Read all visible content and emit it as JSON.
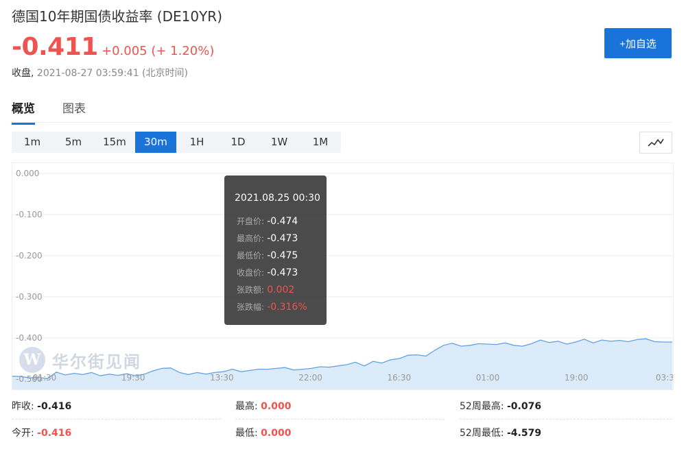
{
  "header": {
    "title": "德国10年期国债收益率 (DE10YR)",
    "price": "-0.411",
    "change": "+0.005 (+ 1.20%)",
    "status_label": "收盘,",
    "status_time": "2021-08-27 03:59:41 (北京时间)",
    "add_button": "+加自选"
  },
  "tabs": [
    "概览",
    "图表"
  ],
  "periods": [
    "1m",
    "5m",
    "15m",
    "30m",
    "1H",
    "1D",
    "1W",
    "1M"
  ],
  "active_period": "30m",
  "tooltip": {
    "date": "2021.08.25 00:30",
    "open_label": "开盘价:",
    "open": "-0.474",
    "high_label": "最高价:",
    "high": "-0.473",
    "low_label": "最低价:",
    "low": "-0.475",
    "close_label": "收盘价:",
    "close": "-0.473",
    "chg_label": "张跌额:",
    "chg": "0.002",
    "pct_label": "张跌幅:",
    "pct": "-0.316%"
  },
  "watermark": {
    "logo": "W",
    "text": "华尔街见闻"
  },
  "chart_data": {
    "type": "area",
    "y_ticks": [
      "0.000",
      "-0.100",
      "-0.200",
      "-0.300",
      "-0.400",
      "-0.500"
    ],
    "y_range": [
      -0.5,
      0.0
    ],
    "x_ticks": [
      "01:30",
      "19:30",
      "13:30",
      "22:00",
      "16:30",
      "01:00",
      "19:00",
      "03:3"
    ],
    "series": [
      {
        "values": [
          -0.493,
          -0.494,
          -0.497,
          -0.496,
          -0.499,
          -0.483,
          -0.49,
          -0.486,
          -0.489,
          -0.484,
          -0.492,
          -0.488,
          -0.491,
          -0.487,
          -0.492,
          -0.488,
          -0.48,
          -0.474,
          -0.473,
          -0.484,
          -0.489,
          -0.484,
          -0.488,
          -0.484,
          -0.482,
          -0.476,
          -0.482,
          -0.479,
          -0.476,
          -0.476,
          -0.474,
          -0.472,
          -0.478,
          -0.476,
          -0.474,
          -0.47,
          -0.471,
          -0.468,
          -0.465,
          -0.459,
          -0.468,
          -0.457,
          -0.461,
          -0.453,
          -0.45,
          -0.442,
          -0.441,
          -0.444,
          -0.43,
          -0.418,
          -0.413,
          -0.42,
          -0.418,
          -0.414,
          -0.415,
          -0.416,
          -0.412,
          -0.418,
          -0.42,
          -0.414,
          -0.405,
          -0.411,
          -0.408,
          -0.415,
          -0.41,
          -0.403,
          -0.412,
          -0.405,
          -0.408,
          -0.406,
          -0.409,
          -0.404,
          -0.402,
          -0.409,
          -0.41,
          -0.41
        ]
      }
    ],
    "colors": {
      "line": "#5fa0e8",
      "fill": "#dcebfa",
      "grid": "#eeeeee"
    }
  },
  "stats": [
    [
      {
        "label": "昨收:",
        "value": "-0.416",
        "red": false
      },
      {
        "label": "最高:",
        "value": "0.000",
        "red": true
      },
      {
        "label": "52周最高:",
        "value": "-0.076",
        "red": false
      }
    ],
    [
      {
        "label": "今开:",
        "value": "-0.416",
        "red": true
      },
      {
        "label": "最低:",
        "value": "0.000",
        "red": true
      },
      {
        "label": "52周最低:",
        "value": "-4.579",
        "red": false
      }
    ]
  ]
}
